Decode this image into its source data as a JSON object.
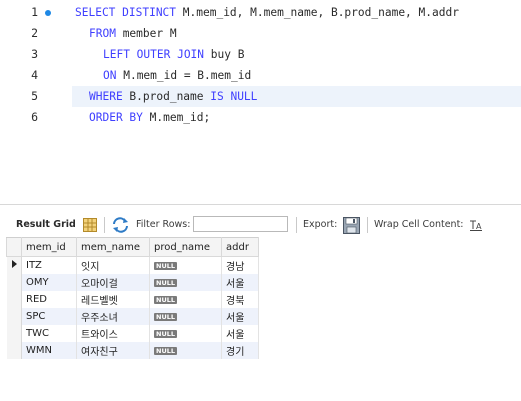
{
  "editor": {
    "lines": [
      {
        "number": "1",
        "text": ""
      },
      {
        "number": "2",
        "text": ""
      },
      {
        "number": "3",
        "text": ""
      },
      {
        "number": "4",
        "text": ""
      },
      {
        "number": "5",
        "text": ""
      },
      {
        "number": "6",
        "text": ""
      }
    ],
    "sql": {
      "l1_kw1": "SELECT DISTINCT",
      "l1_rest": " M.mem_id, M.mem_name, B.prod_name, M.addr",
      "l2_kw": "FROM",
      "l2_rest": " member M",
      "l3_kw": "LEFT OUTER JOIN",
      "l3_rest": " buy B",
      "l4_kw": "ON",
      "l4_rest": " M.mem_id = B.mem_id",
      "l5_kw": "WHERE",
      "l5_mid": " B.prod_name ",
      "l5_kw2": "IS NULL",
      "l6_kw": "ORDER BY",
      "l6_rest": " M.mem_id;"
    },
    "keyword_color": "#3f3fff"
  },
  "toolbar": {
    "result_grid_label": "Result Grid",
    "filter_rows_label": "Filter Rows:",
    "filter_value": "",
    "export_label": "Export:",
    "wrap_label": "Wrap Cell Content:"
  },
  "grid": {
    "columns": [
      "mem_id",
      "mem_name",
      "prod_name",
      "addr"
    ],
    "null_label": "NULL",
    "rows": [
      {
        "mem_id": "ITZ",
        "mem_name": "잇지",
        "prod_name": "NULL",
        "addr": "경남"
      },
      {
        "mem_id": "OMY",
        "mem_name": "오마이걸",
        "prod_name": "NULL",
        "addr": "서울"
      },
      {
        "mem_id": "RED",
        "mem_name": "레드벨벳",
        "prod_name": "NULL",
        "addr": "경북"
      },
      {
        "mem_id": "SPC",
        "mem_name": "우주소녀",
        "prod_name": "NULL",
        "addr": "서울"
      },
      {
        "mem_id": "TWC",
        "mem_name": "트와이스",
        "prod_name": "NULL",
        "addr": "서울"
      },
      {
        "mem_id": "WMN",
        "mem_name": "여자친구",
        "prod_name": "NULL",
        "addr": "경기"
      }
    ]
  },
  "icons": {
    "grid": "grid-layout-icon",
    "refresh": "refresh-arrows-icon",
    "export": "export-save-icon",
    "wrap": "wrap-text-icon",
    "row_marker": "current-row-arrow-icon"
  }
}
